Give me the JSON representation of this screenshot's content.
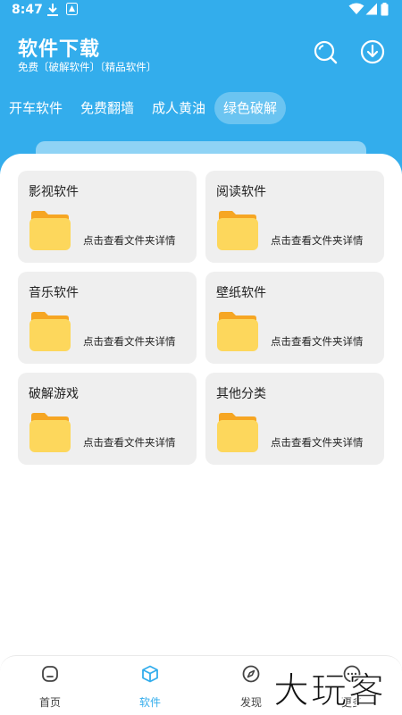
{
  "status_bar": {
    "time": "8:47"
  },
  "header": {
    "title": "软件下载",
    "subtitle": "免费〔破解软件〕〔精品软件〕"
  },
  "tabs": [
    {
      "label": "开车软件"
    },
    {
      "label": "免费翻墙"
    },
    {
      "label": "成人黄油"
    },
    {
      "label": "绿色破解",
      "active": true
    }
  ],
  "cards": [
    {
      "title": "影视软件",
      "hint": "点击查看文件夹详情"
    },
    {
      "title": "阅读软件",
      "hint": "点击查看文件夹详情"
    },
    {
      "title": "音乐软件",
      "hint": "点击查看文件夹详情"
    },
    {
      "title": "壁纸软件",
      "hint": "点击查看文件夹详情"
    },
    {
      "title": "破解游戏",
      "hint": "点击查看文件夹详情"
    },
    {
      "title": "其他分类",
      "hint": "点击查看文件夹详情"
    }
  ],
  "bottom_nav": [
    {
      "label": "首页",
      "icon": "home-icon"
    },
    {
      "label": "软件",
      "icon": "cube-icon",
      "active": true
    },
    {
      "label": "发现",
      "icon": "compass-icon"
    },
    {
      "label": "更多",
      "icon": "more-icon"
    }
  ],
  "watermark": {
    "text": "大玩客"
  },
  "colors": {
    "primary": "#33adec",
    "card_bg": "#efefef",
    "folder": "#fdd75c"
  }
}
